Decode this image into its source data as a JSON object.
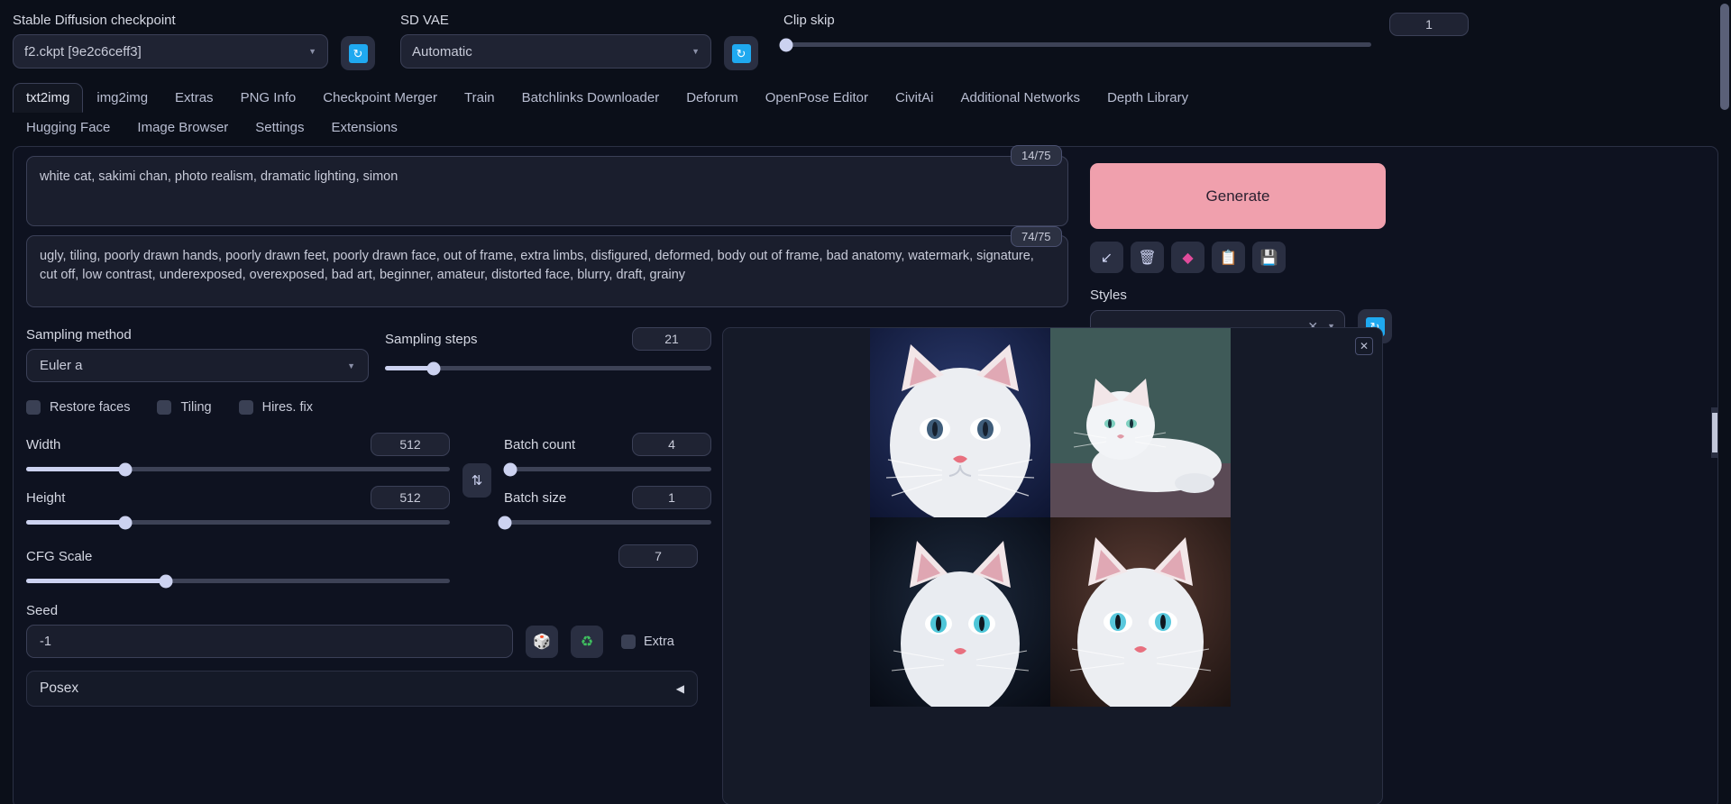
{
  "topbar": {
    "checkpoint": {
      "label": "Stable Diffusion checkpoint",
      "value": "f2.ckpt [9e2c6ceff3]"
    },
    "vae": {
      "label": "SD VAE",
      "value": "Automatic"
    },
    "clip_skip": {
      "label": "Clip skip",
      "value": "1",
      "slider_pct": 0
    },
    "refresh_icon": "refresh-icon"
  },
  "tabs": {
    "row1": [
      {
        "label": "txt2img",
        "active": true
      },
      {
        "label": "img2img",
        "active": false
      },
      {
        "label": "Extras",
        "active": false
      },
      {
        "label": "PNG Info",
        "active": false
      },
      {
        "label": "Checkpoint Merger",
        "active": false
      },
      {
        "label": "Train",
        "active": false
      },
      {
        "label": "Batchlinks Downloader",
        "active": false
      },
      {
        "label": "Deforum",
        "active": false
      },
      {
        "label": "OpenPose Editor",
        "active": false
      },
      {
        "label": "CivitAi",
        "active": false
      },
      {
        "label": "Additional Networks",
        "active": false
      },
      {
        "label": "Depth Library",
        "active": false
      }
    ],
    "row2": [
      {
        "label": "Hugging Face",
        "active": false
      },
      {
        "label": "Image Browser",
        "active": false
      },
      {
        "label": "Settings",
        "active": false
      },
      {
        "label": "Extensions",
        "active": false
      }
    ]
  },
  "prompt": {
    "positive": "white cat, sakimi chan, photo realism, dramatic lighting, simon",
    "positive_tokens": "14/75",
    "negative": "ugly, tiling, poorly drawn hands, poorly drawn feet, poorly drawn face, out of frame, extra limbs, disfigured, deformed, body out of frame, bad anatomy, watermark, signature, cut off, low contrast, underexposed, overexposed, bad art, beginner, amateur, distorted face, blurry, draft, grainy",
    "negative_tokens": "74/75"
  },
  "generate": {
    "label": "Generate",
    "color": "#f0a0ad",
    "tools": [
      {
        "name": "arrow-down-left-icon",
        "glyph": "↙"
      },
      {
        "name": "trash-icon",
        "glyph": "🗑"
      },
      {
        "name": "palette-icon",
        "glyph": "◆"
      },
      {
        "name": "clipboard-icon",
        "glyph": "📋"
      },
      {
        "name": "save-icon",
        "glyph": "💾"
      }
    ]
  },
  "styles": {
    "label": "Styles",
    "value": "",
    "clear_icon": "clear-icon",
    "refresh_icon": "refresh-icon"
  },
  "settings": {
    "sampling_method": {
      "label": "Sampling method",
      "value": "Euler a"
    },
    "sampling_steps": {
      "label": "Sampling steps",
      "value": "21",
      "slider_pct": 15
    },
    "checkboxes": [
      {
        "label": "Restore faces",
        "checked": false
      },
      {
        "label": "Tiling",
        "checked": false
      },
      {
        "label": "Hires. fix",
        "checked": false
      }
    ],
    "width": {
      "label": "Width",
      "value": "512",
      "slider_pct": 23.5
    },
    "height": {
      "label": "Height",
      "value": "512",
      "slider_pct": 23.5
    },
    "swap_icon": "swap-arrows-icon",
    "batch_count": {
      "label": "Batch count",
      "value": "4",
      "slider_pct": 3
    },
    "batch_size": {
      "label": "Batch size",
      "value": "1",
      "slider_pct": 0
    },
    "cfg_scale": {
      "label": "CFG Scale",
      "value": "7",
      "slider_pct": 21
    },
    "seed": {
      "label": "Seed",
      "value": "-1"
    },
    "seed_buttons": [
      {
        "name": "dice-icon",
        "glyph": "🎲"
      },
      {
        "name": "recycle-icon",
        "glyph": "♻"
      }
    ],
    "extra": {
      "label": "Extra",
      "checked": false
    },
    "posex": {
      "label": "Posex",
      "collapse_icon": "triangle-left-icon",
      "glyph": "◀"
    }
  },
  "gallery": {
    "close_icon": "close-icon",
    "images": [
      {
        "name": "white-cat-closeup-blue-bg"
      },
      {
        "name": "white-cat-lying-teal-bg"
      },
      {
        "name": "white-cat-portrait-dark-bg"
      },
      {
        "name": "white-cat-portrait-brown-bg"
      }
    ]
  }
}
